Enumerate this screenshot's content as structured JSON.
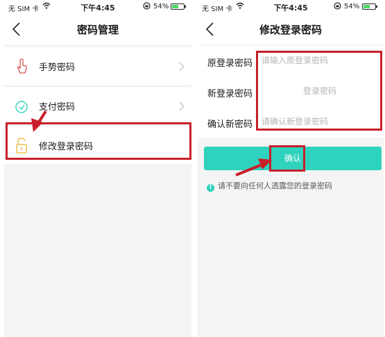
{
  "status": {
    "carrier": "无 SIM 卡",
    "time": "下午4:45",
    "battery_pct": "54%",
    "battery_level": 0.54
  },
  "left": {
    "title": "密码管理",
    "items": [
      {
        "label": "手势密码",
        "icon": "gesture-hand-icon"
      },
      {
        "label": "支付密码",
        "icon": "payment-lock-icon"
      },
      {
        "label": "修改登录密码",
        "icon": "unlock-icon"
      }
    ]
  },
  "right": {
    "title": "修改登录密码",
    "fields": [
      {
        "label": "原登录密码",
        "placeholder": "请输入原登录密码"
      },
      {
        "label": "新登录密码",
        "placeholder": "登录密码"
      },
      {
        "label": "确认新密码",
        "placeholder": "请确认新登录密码"
      }
    ],
    "confirm_label": "确认",
    "tip": "请不要向任何人透露您的登录密码"
  },
  "colors": {
    "accent": "#2fd3bd",
    "highlight": "#c8202a",
    "lock_icon": "#e8c24a"
  }
}
